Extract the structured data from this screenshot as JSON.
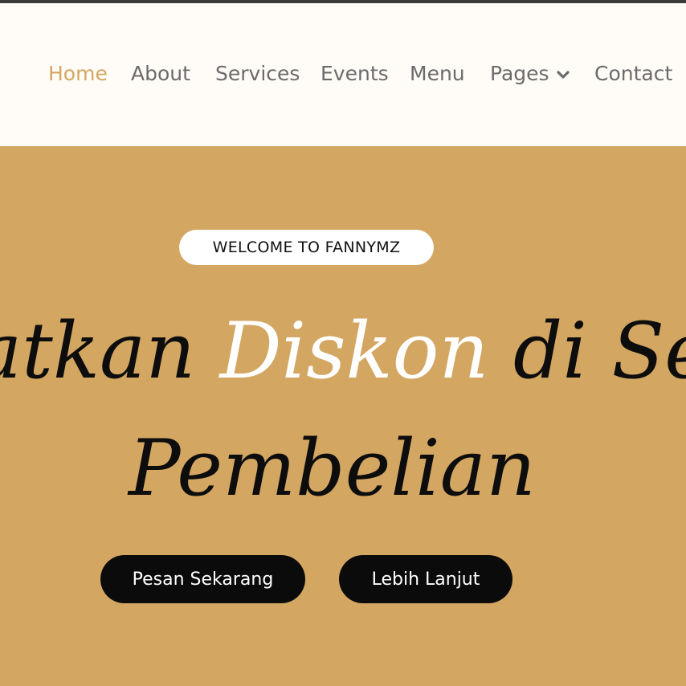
{
  "nav": {
    "items": [
      {
        "label": "Home",
        "active": true
      },
      {
        "label": "About"
      },
      {
        "label": "Services"
      },
      {
        "label": "Events"
      },
      {
        "label": "Menu"
      },
      {
        "label": "Pages",
        "icon": "chevron-down-icon"
      },
      {
        "label": "Contact"
      }
    ]
  },
  "hero": {
    "badge": "WELCOME TO FANNYMZ",
    "headline_part1": "atkan ",
    "headline_highlight": "Diskon",
    "headline_part2": " di Set",
    "headline_line2": "Pembelian",
    "primary_button": "Pesan Sekarang",
    "secondary_button": "Lebih Lanjut"
  },
  "colors": {
    "accent": "#d4a762",
    "hero_background": "#d3a662",
    "nav_background": "#fffbf7",
    "button_background": "#0b0b0c"
  }
}
